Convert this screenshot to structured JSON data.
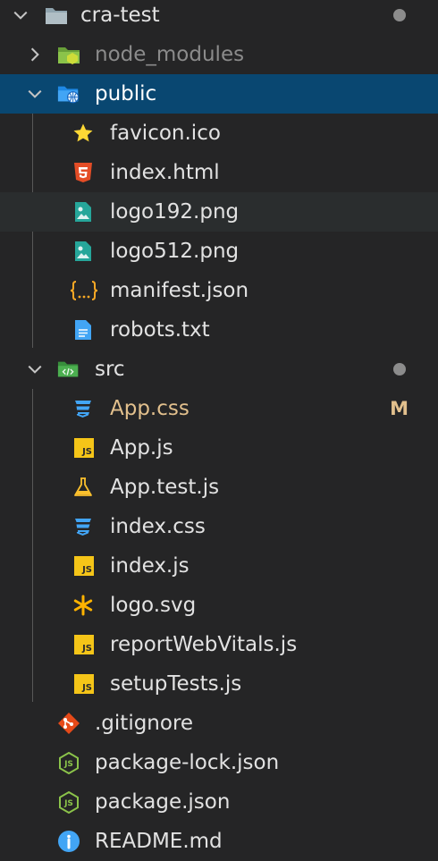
{
  "explorer": {
    "root": {
      "label": "cra-test",
      "icon": "folder-icon",
      "has_changes_dot": true
    },
    "node_modules": {
      "label": "node_modules",
      "icon": "node-folder-icon"
    },
    "public": {
      "label": "public",
      "icon": "globe-folder-icon",
      "children": [
        {
          "label": "favicon.ico",
          "icon": "star-icon"
        },
        {
          "label": "index.html",
          "icon": "html5-icon"
        },
        {
          "label": "logo192.png",
          "icon": "image-icon"
        },
        {
          "label": "logo512.png",
          "icon": "image-icon"
        },
        {
          "label": "manifest.json",
          "icon": "json-braces-icon"
        },
        {
          "label": "robots.txt",
          "icon": "text-file-icon"
        }
      ]
    },
    "src": {
      "label": "src",
      "icon": "code-folder-icon",
      "has_changes_dot": true,
      "children": [
        {
          "label": "App.css",
          "icon": "css3-icon",
          "badge": "M"
        },
        {
          "label": "App.js",
          "icon": "javascript-icon"
        },
        {
          "label": "App.test.js",
          "icon": "flask-icon"
        },
        {
          "label": "index.css",
          "icon": "css3-icon"
        },
        {
          "label": "index.js",
          "icon": "javascript-icon"
        },
        {
          "label": "logo.svg",
          "icon": "svg-asterisk-icon"
        },
        {
          "label": "reportWebVitals.js",
          "icon": "javascript-icon"
        },
        {
          "label": "setupTests.js",
          "icon": "javascript-icon"
        }
      ]
    },
    "files": [
      {
        "label": ".gitignore",
        "icon": "git-icon"
      },
      {
        "label": "package-lock.json",
        "icon": "nodejs-icon"
      },
      {
        "label": "package.json",
        "icon": "nodejs-icon"
      },
      {
        "label": "README.md",
        "icon": "info-icon"
      }
    ],
    "colors": {
      "selected_bg": "#094771",
      "modified_text": "#e2c08d",
      "background": "#252526"
    }
  }
}
